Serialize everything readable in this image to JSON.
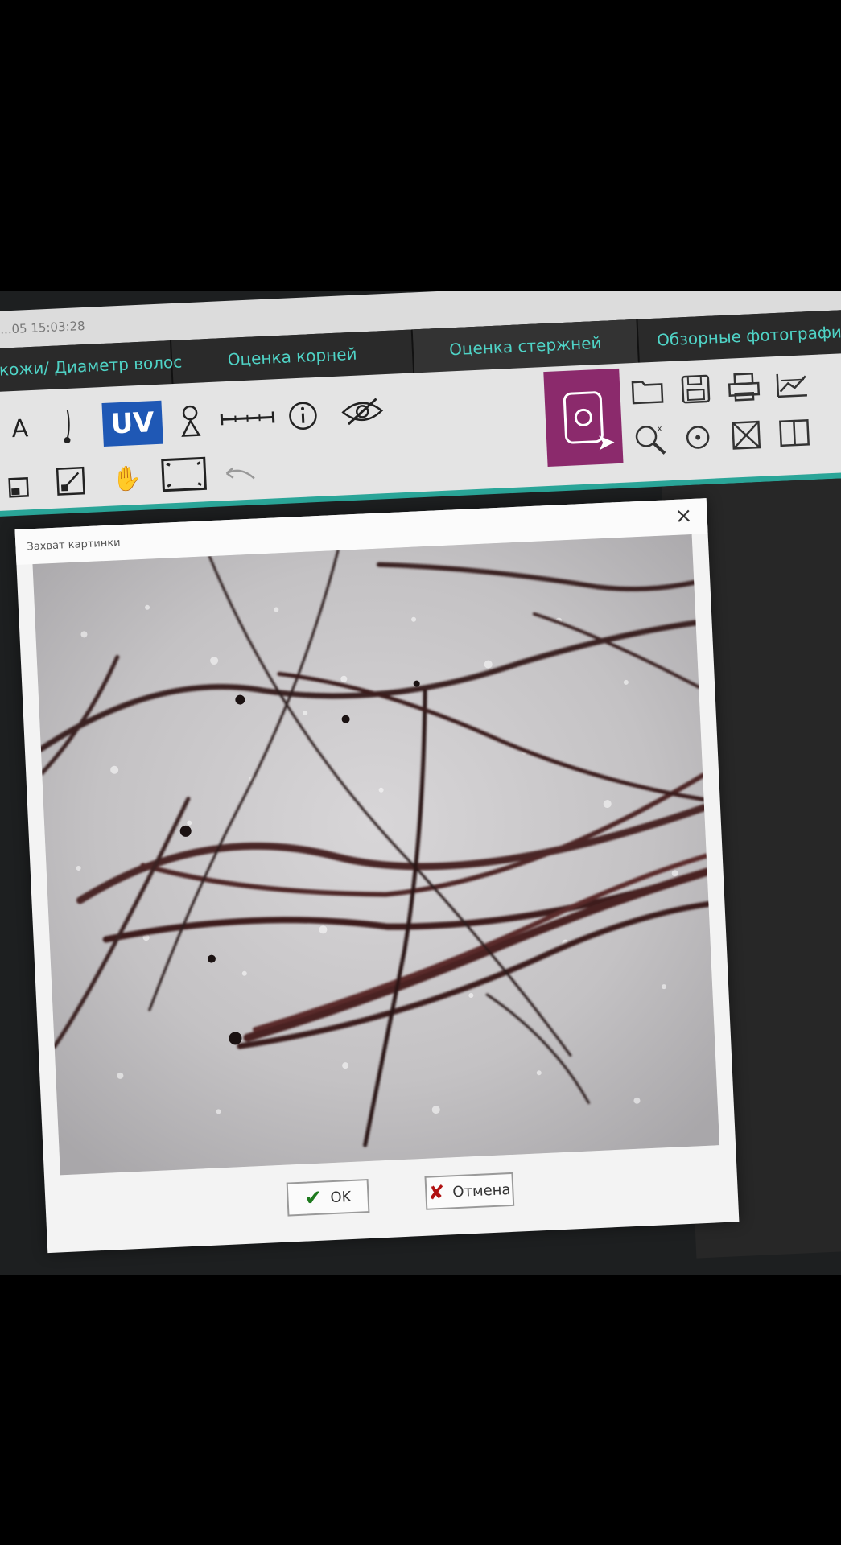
{
  "window": {
    "timestamp": "...05 15:03:28"
  },
  "tabs": [
    {
      "label": "...и кожи/ Диаметр волос"
    },
    {
      "label": "Оценка корней"
    },
    {
      "label": "Оценка стержней"
    },
    {
      "label": "Обзорные фотографии"
    }
  ],
  "toolbar": {
    "uv_label": "UV",
    "icons": [
      "hair-tool-icon",
      "uv-icon",
      "person-pin-icon",
      "ruler-icon",
      "info-icon",
      "eye-hidden-icon",
      "crop-icon",
      "resize-icon",
      "hand-icon",
      "fit-frame-icon",
      "undo-arrow-icon",
      "camera-capture-icon",
      "folder-icon",
      "save-icon",
      "print-icon",
      "chart-icon",
      "zoom-reset-icon",
      "target-icon",
      "no-image-icon",
      "split-view-icon"
    ]
  },
  "dialog": {
    "title": "Захват картинки",
    "close_label": "×",
    "ok_label": "OK",
    "cancel_label": "Отмена"
  },
  "colors": {
    "tab_text": "#4fd3c6",
    "accent_teal": "#2aa598",
    "capture_button": "#8b2a6c",
    "uv_button": "#1f58b5",
    "ok_check": "#1e7a1e",
    "cancel_cross": "#b01010"
  }
}
